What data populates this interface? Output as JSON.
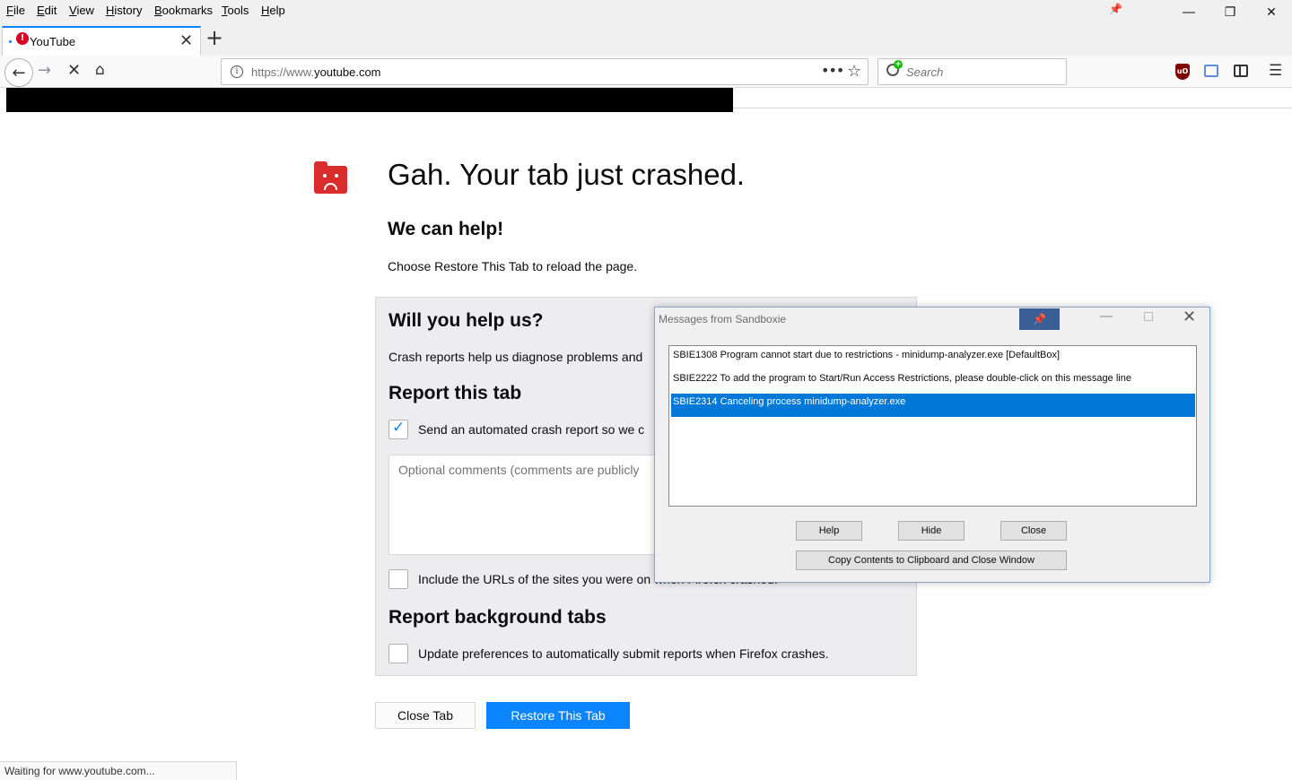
{
  "menubar": {
    "items": [
      {
        "accel": "F",
        "rest": "ile"
      },
      {
        "accel": "E",
        "rest": "dit"
      },
      {
        "accel": "V",
        "rest": "iew"
      },
      {
        "accel": "H",
        "rest": "istory"
      },
      {
        "accel": "B",
        "rest": "ookmarks"
      },
      {
        "accel": "T",
        "rest": "ools"
      },
      {
        "accel": "H",
        "rest": "elp"
      }
    ],
    "icons": {
      "pin": "pin-icon",
      "minimize": "minimize-icon",
      "maximize": "restore-icon",
      "close": "close-icon"
    }
  },
  "tabs": [
    {
      "title": "YouTube",
      "icon": "alert-icon"
    }
  ],
  "nav": {
    "url_scheme": "https://www.",
    "url_host": "youtube.com",
    "search_placeholder": "Search",
    "info_glyph": "i",
    "ublock_label": "uO"
  },
  "crash_page": {
    "title": "Gah. Your tab just crashed.",
    "help_heading": "We can help!",
    "help_text": "Choose Restore This Tab to reload the page.",
    "will_you_help": "Will you help us?",
    "crash_reports_text": "Crash reports help us diagnose problems and",
    "report_tab_heading": "Report this tab",
    "send_report_label": "Send an automated crash report so we c",
    "send_report_checked": true,
    "comments_placeholder": "Optional comments (comments are publicly",
    "include_urls_label": "Include the URLs of the sites you were on when Firefox crashed.",
    "include_urls_checked": false,
    "report_background_heading": "Report background tabs",
    "update_prefs_label": "Update preferences to automatically submit reports when Firefox crashes.",
    "update_prefs_checked": false,
    "close_tab_label": "Close Tab",
    "restore_tab_label": "Restore This Tab"
  },
  "status": {
    "text": "Waiting for www.youtube.com..."
  },
  "sandboxie": {
    "title": "Messages from Sandboxie",
    "messages": [
      "SBIE1308 Program cannot start due to restrictions - minidump-analyzer.exe [DefaultBox]",
      "SBIE2222 To add the program to Start/Run Access Restrictions, please double-click on this message line",
      "SBIE2314 Canceling process minidump-analyzer.exe"
    ],
    "selected_index": 2,
    "help_label": "Help",
    "hide_label": "Hide",
    "close_label": "Close",
    "copy_label": "Copy Contents to Clipboard and Close Window"
  },
  "colors": {
    "accent": "#0a84ff",
    "crash_red": "#d92d2d",
    "selection": "#0078d7"
  }
}
